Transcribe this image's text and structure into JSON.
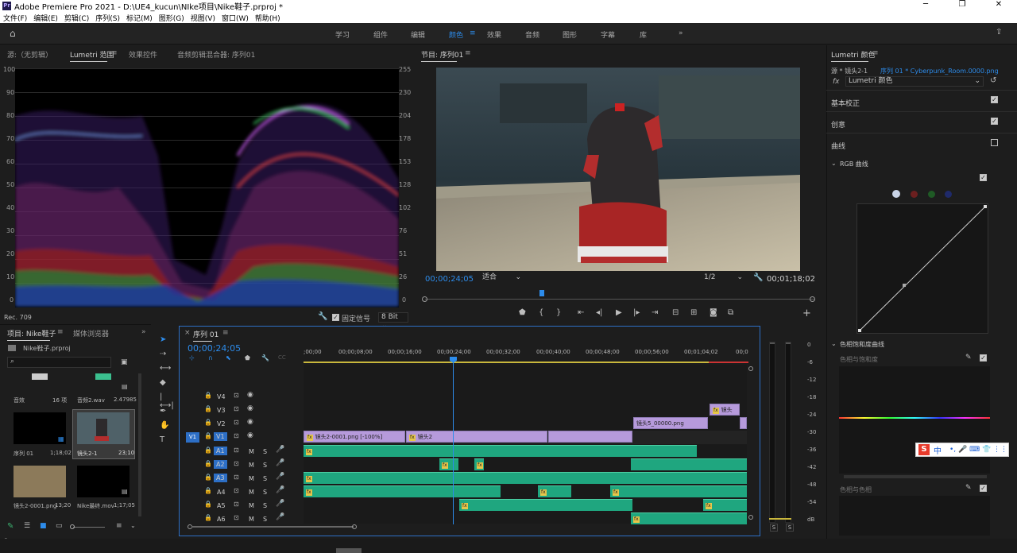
{
  "app": {
    "title": "Adobe Premiere Pro 2021 - D:\\UE4_kucun\\NIke项目\\Nike鞋子.prproj *",
    "logo_text": "Pr"
  },
  "menu": [
    "文件(F)",
    "编辑(E)",
    "剪辑(C)",
    "序列(S)",
    "标记(M)",
    "图形(G)",
    "视图(V)",
    "窗口(W)",
    "帮助(H)"
  ],
  "workspaces": [
    "学习",
    "组件",
    "编辑",
    "颜色",
    "效果",
    "音频",
    "图形",
    "字幕",
    "库"
  ],
  "active_workspace": "颜色",
  "source_panel": {
    "tabs": [
      "源:（无剪辑）",
      "Lumetri 范围",
      "效果控件",
      "音频剪辑混合器: 序列01"
    ],
    "active_tab": "Lumetri 范围",
    "y_left": [
      "100",
      "90",
      "80",
      "70",
      "60",
      "50",
      "40",
      "30",
      "20",
      "10",
      "0"
    ],
    "y_right": [
      "255",
      "230",
      "204",
      "178",
      "153",
      "128",
      "102",
      "76",
      "51",
      "26",
      "0"
    ],
    "colorspace": "Rec. 709",
    "clamp_label": "固定信号",
    "bit_depth": "8 Bit"
  },
  "program_monitor": {
    "title": "节目: 序列01",
    "timecode": "00;00;24;05",
    "fit": "适合",
    "resolution": "1/2",
    "duration": "00;01;18;02"
  },
  "lumetri": {
    "title": "Lumetri 颜色",
    "source_label": "源 * 镜头2-1",
    "sequence_label": "序列 01 * Cyberpunk_Room.0000.png",
    "fx_label": "Lumetri 颜色",
    "sections": [
      "基本校正",
      "创意",
      "曲线"
    ],
    "rgb_curves": "RGB 曲线",
    "hue_sat_curves": "色相饱和度曲线",
    "hue_vs_sat": "色相与饱和度",
    "hue_vs_hue": "色相与色相"
  },
  "project": {
    "tabs": [
      "项目: Nike鞋子",
      "媒体浏览器"
    ],
    "file": "Nike鞋子.prproj",
    "items": [
      {
        "name": "音效",
        "info": "16 项"
      },
      {
        "name": "音频2.wav",
        "info": "2.47985"
      },
      {
        "name": "序列 01",
        "info": "1;18;02"
      },
      {
        "name": "镜头2-1",
        "info": "23;10"
      },
      {
        "name": "镜头2-0001.png",
        "info": "13;20"
      },
      {
        "name": "Nike最终.mov",
        "info": "1;17;05"
      }
    ]
  },
  "timeline": {
    "tab": "序列 01",
    "timecode": "00;00;24;05",
    "ruler": [
      ";00;00",
      "00;00;08;00",
      "00;00;16;00",
      "00;00;24;00",
      "00;00;32;00",
      "00;00;40;00",
      "00;00;48;00",
      "00;00;56;00",
      "00;01;04;02",
      "00;0"
    ],
    "tracks": [
      "V4",
      "V3",
      "V2",
      "V1",
      "A1",
      "A2",
      "A3",
      "A4",
      "A5",
      "A6"
    ],
    "clips": {
      "v1_a": "镜头2-0001.png [-100%]",
      "v1_b": "镜头2",
      "v2_a": "镜头5_00000.png",
      "v3_a": "镜头"
    }
  },
  "meter": {
    "labels": [
      "0",
      "-6",
      "-12",
      "-18",
      "-24",
      "-30",
      "-36",
      "-42",
      "-48",
      "-54",
      "dB"
    ],
    "solo": [
      "S",
      "S"
    ]
  },
  "ime": {
    "logo": "S",
    "label": "中"
  }
}
